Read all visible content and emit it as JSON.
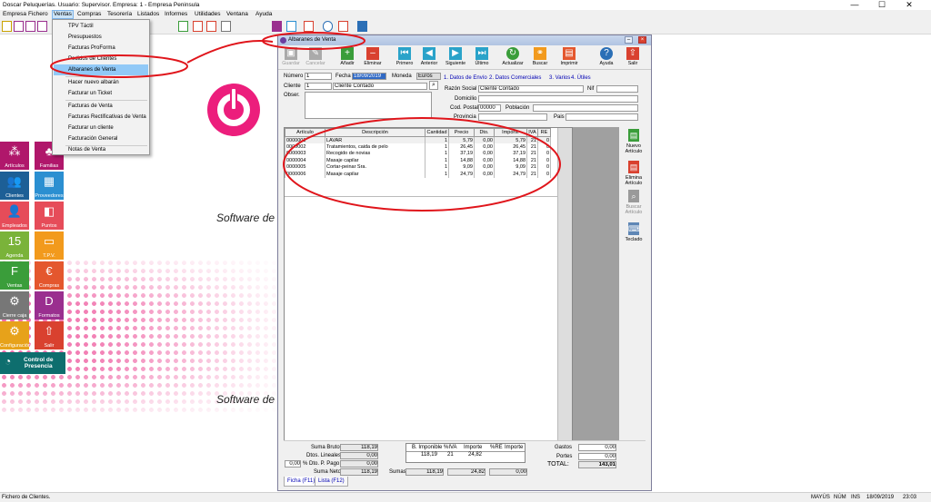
{
  "app": {
    "title": "Doscar Peluquerías. Usuario: Supervisor. Empresa: 1 - Empresa Peninsula"
  },
  "window_controls": {
    "minimize": "—",
    "maximize": "☐",
    "close": "✕"
  },
  "menubar": [
    "Empresa",
    "Fichero",
    "Ventas",
    "Compras",
    "Tesorería",
    "Listados",
    "Informes",
    "Utilidades",
    "Ventana",
    "Ayuda"
  ],
  "ventas_menu": [
    "TPV Táctil",
    "Presupuestos",
    "Facturas ProForma",
    "Pedidos de Clientes",
    "Albaranes de Venta",
    "Hacer nuevo albarán",
    "Facturar un Ticket",
    "Facturas de Venta",
    "Facturas Rectificativas de Venta",
    "Facturar un cliente",
    "Facturación General",
    "Notas de Venta"
  ],
  "brand": {
    "tagline": "Software de",
    "tagline2": "Software de",
    "color": "#ec1e7c"
  },
  "tiles": [
    {
      "label": "Artículos",
      "icon": "⁂",
      "color": "#b0176b"
    },
    {
      "label": "Familias",
      "icon": "♣",
      "color": "#b0176b"
    },
    {
      "label": "Clientes",
      "icon": "👥",
      "color": "#1d5f96"
    },
    {
      "label": "Proveedores",
      "icon": "▦",
      "color": "#2b8fd1"
    },
    {
      "label": "Empleados",
      "icon": "👤",
      "color": "#e64c59"
    },
    {
      "label": "Puntos",
      "icon": "◧",
      "color": "#e64c59"
    },
    {
      "label": "Agenda",
      "icon": "15",
      "color": "#7ab33a"
    },
    {
      "label": "T.P.V.",
      "icon": "▭",
      "color": "#f29a1d"
    },
    {
      "label": "Ventas",
      "icon": "F",
      "color": "#3a9d3a"
    },
    {
      "label": "Compras",
      "icon": "€",
      "color": "#e4572e"
    },
    {
      "label": "Cierre caja",
      "icon": "⚙",
      "color": "#777777"
    },
    {
      "label": "Formatos",
      "icon": "D",
      "color": "#9a2f8f"
    },
    {
      "label": "Configuración",
      "icon": "⚙",
      "color": "#e7a21a"
    },
    {
      "label": "Salir",
      "icon": "⇧",
      "color": "#d9412f"
    }
  ],
  "control_presencia": {
    "line1": "Control de",
    "line2": "Presencia"
  },
  "doc": {
    "title": "Albaranes de Venta",
    "toolbar": [
      "Guardar",
      "Cancelar",
      "Añadir",
      "Eliminar",
      "Primero",
      "Anterior",
      "Siguiente",
      "Último",
      "Actualizar",
      "Buscar",
      "Imprimir",
      "Ayuda",
      "Salir"
    ],
    "numero_label": "Número",
    "numero": "1",
    "fecha_label": "Fecha",
    "fecha": "18/09/2019",
    "moneda_label": "Moneda",
    "moneda": "Euros",
    "cliente_label": "Cliente",
    "cliente_code": "1",
    "cliente_name": "Cliente Contado",
    "obser_label": "Obser.",
    "tabs": [
      "1. Datos de Envío",
      "2. Datos Comerciales",
      "3. Varios",
      "4. Útiles"
    ],
    "razon_label": "Razón Social",
    "razon": "Cliente Contado",
    "nif_label": "Nif",
    "domicilio_label": "Domicilio",
    "cp_label": "Cod. Postal",
    "cp": "00000",
    "poblacion_label": "Población",
    "provincia_label": "Provincia",
    "pais_label": "Pais",
    "columns": [
      "Artículo",
      "Descripción",
      "Cantidad",
      "Precio",
      "Dto.",
      "Importe",
      "IVA",
      "RE"
    ],
    "lines": [
      [
        "0000001",
        "LAVAR",
        "1",
        "5,79",
        "0,00",
        "5,79",
        "21",
        "0"
      ],
      [
        "0000002",
        "Tratamientos, caida de pelo",
        "1",
        "26,45",
        "0,00",
        "26,45",
        "21",
        "0"
      ],
      [
        "0000003",
        "Recogido de novias",
        "1",
        "37,19",
        "0,00",
        "37,19",
        "21",
        "0"
      ],
      [
        "0000004",
        "Masaje capilar",
        "1",
        "14,88",
        "0,00",
        "14,88",
        "21",
        "0"
      ],
      [
        "0000005",
        "Cortar-peinar Sra.",
        "1",
        "9,09",
        "0,00",
        "9,09",
        "21",
        "0"
      ],
      [
        "0000006",
        "Masaje capilar",
        "1",
        "24,79",
        "0,00",
        "24,79",
        "21",
        "0"
      ]
    ],
    "side_buttons": [
      {
        "label": "Nuevo Artículo",
        "icon": "▤",
        "color": "#3a9d3a"
      },
      {
        "label": "Elimina Artículo",
        "icon": "▤",
        "color": "#d9412f"
      },
      {
        "label": "Buscar Artículo",
        "icon": "⌕",
        "color": "#9a9a9a"
      },
      {
        "label": "Teclado",
        "icon": "⌨",
        "color": "#5f87b6"
      }
    ],
    "totals": {
      "suma_bruto_label": "Suma Bruto",
      "suma_bruto": "118,19",
      "dtos_lineales_label": "Dtos. Lineales",
      "dtos_lineales": "0,00",
      "dto_pp_pct": "0,00",
      "dto_pp_label": "% Dto. P. Pago",
      "dto_pp": "0,00",
      "suma_neto_label": "Suma Neto",
      "suma_neto": "118,19",
      "iva_cols": [
        "B. Imponible",
        "%IVA",
        "Importe",
        "%RE",
        "Importe"
      ],
      "iva_row": [
        "118,19",
        "21",
        "24,82",
        "",
        ""
      ],
      "sumas_label": "Sumas",
      "sumas": [
        "118,19",
        "24,82",
        "0,00"
      ],
      "gastos_label": "Gastos",
      "gastos": "0,00",
      "portes_label": "Portes",
      "portes": "0,00",
      "total_label": "TOTAL:",
      "total": "143,01"
    },
    "bottom_tabs": [
      "Ficha (F11)",
      "Lista (F12)"
    ]
  },
  "status": {
    "message": "Fichero de Clientes.",
    "mayus": "MAYÚS",
    "num": "NÚM",
    "ins": "INS",
    "date": "18/09/2019",
    "time": "23:03"
  },
  "annotation_color": "#e0151b"
}
